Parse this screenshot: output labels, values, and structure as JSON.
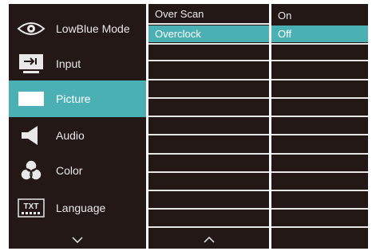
{
  "main_menu": {
    "items": [
      {
        "label": "LowBlue Mode",
        "icon": "eye-icon",
        "selected": false
      },
      {
        "label": "Input",
        "icon": "input-icon",
        "selected": false
      },
      {
        "label": "Picture",
        "icon": "picture-icon",
        "selected": true
      },
      {
        "label": "Audio",
        "icon": "speaker-icon",
        "selected": false
      },
      {
        "label": "Color",
        "icon": "color-circles-icon",
        "selected": false
      },
      {
        "label": "Language",
        "icon": "language-txt-icon",
        "selected": false
      }
    ],
    "nav_down_icon": "chevron-down-icon"
  },
  "submenu": {
    "items": [
      {
        "label": "Over Scan",
        "selected": false
      },
      {
        "label": "Overclock",
        "selected": true
      }
    ],
    "nav_up_icon": "chevron-up-icon"
  },
  "options": {
    "items": [
      {
        "label": "On",
        "selected": false
      },
      {
        "label": "Off",
        "selected": true
      }
    ]
  },
  "language_icon_text": "TXT",
  "colors": {
    "background": "#231815",
    "highlight": "#4bb0b3",
    "text": "#e8e8e8"
  }
}
